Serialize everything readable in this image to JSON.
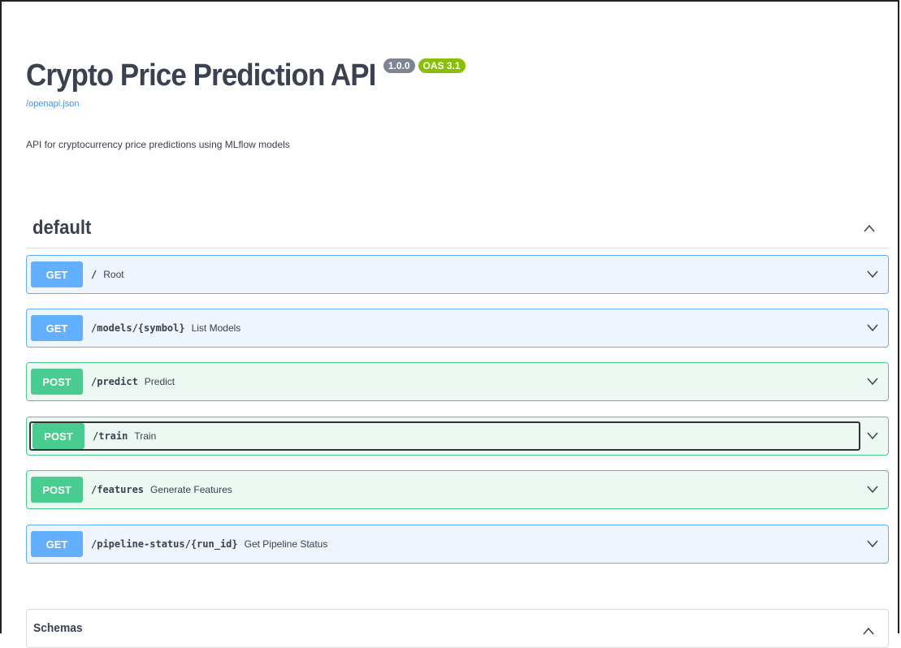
{
  "info": {
    "title": "Crypto Price Prediction API",
    "version_badge": "1.0.0",
    "oas_badge": "OAS 3.1",
    "spec_link": "/openapi.json",
    "description": "API for cryptocurrency price predictions using MLflow models"
  },
  "tag": {
    "name": "default",
    "chevron": "chevron-up-icon"
  },
  "operations": [
    {
      "method": "GET",
      "path": "/",
      "summary": "Root"
    },
    {
      "method": "GET",
      "path": "/models/{symbol}",
      "summary": "List Models"
    },
    {
      "method": "POST",
      "path": "/predict",
      "summary": "Predict"
    },
    {
      "method": "POST",
      "path": "/train",
      "summary": "Train"
    },
    {
      "method": "POST",
      "path": "/features",
      "summary": "Generate Features"
    },
    {
      "method": "GET",
      "path": "/pipeline-status/{run_id}",
      "summary": "Get Pipeline Status"
    }
  ],
  "schemas": {
    "title": "Schemas"
  },
  "colors": {
    "get": "#61affe",
    "post": "#49cc90",
    "text": "#3b4151",
    "version_badge": "#7d8492",
    "oas_badge": "#89bf04",
    "link": "#4990e2"
  }
}
